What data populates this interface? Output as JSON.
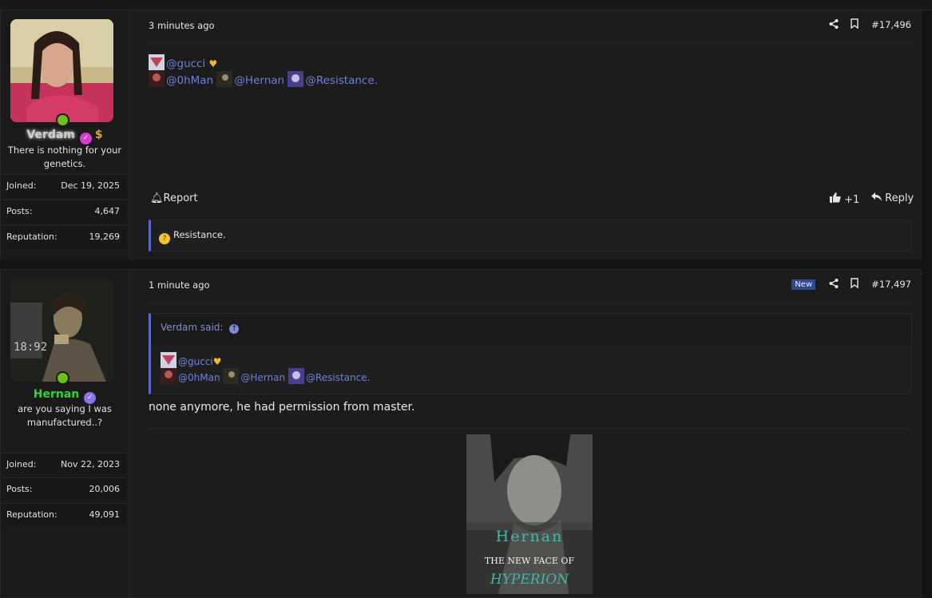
{
  "posts": [
    {
      "user": {
        "name": "Verdam",
        "title": "There is nothing for your genetics.",
        "stats": [
          {
            "label": "Joined:",
            "value": "Dec 19, 2025"
          },
          {
            "label": "Posts:",
            "value": "4,647"
          },
          {
            "label": "Reputation:",
            "value": "19,269"
          }
        ]
      },
      "time": "3 minutes ago",
      "number": "#17,496",
      "mentions_line1": "@gucci",
      "mentions_line2": [
        "@0hMan",
        "@Hernan",
        "@Resistance."
      ],
      "report_label": "Report",
      "like_count": "+1",
      "reply_label": "Reply",
      "reaction_text": "Resistance."
    },
    {
      "user": {
        "name": "Hernan",
        "title": "are you saying I was manufactured..?",
        "stats": [
          {
            "label": "Joined:",
            "value": "Nov 22, 2023"
          },
          {
            "label": "Posts:",
            "value": "20,006"
          },
          {
            "label": "Reputation:",
            "value": "49,091"
          }
        ]
      },
      "time": "1 minute ago",
      "new_badge": "New",
      "number": "#17,497",
      "quote": {
        "author": "Verdam said:",
        "mentions_line1": "@gucci",
        "mentions_line2": [
          "@0hMan",
          "@Hernan",
          "@Resistance."
        ]
      },
      "body": "none anymore, he had permission from master.",
      "poster": {
        "line1": "Hernan",
        "line2": "THE NEW FACE OF",
        "line3": "HYPERION"
      }
    }
  ],
  "icons": {
    "share": "share-icon",
    "bookmark": "bookmark-icon",
    "bell": "bell-icon",
    "thumb": "thumbs-up-icon",
    "reply": "reply-icon",
    "arrow_up": "arrow-up-circle-icon",
    "verified": "verified-badge-icon",
    "dollar": "dollar-icon",
    "heart": "heart-icon",
    "emoji": "thinking-face-icon"
  },
  "colors": {
    "mention": "#6f7fd6",
    "online": "#6fbf1f",
    "hernan_name": "#2fd62f",
    "quote_border": "#5a6ac8",
    "new_badge": "#2e4a8f"
  }
}
